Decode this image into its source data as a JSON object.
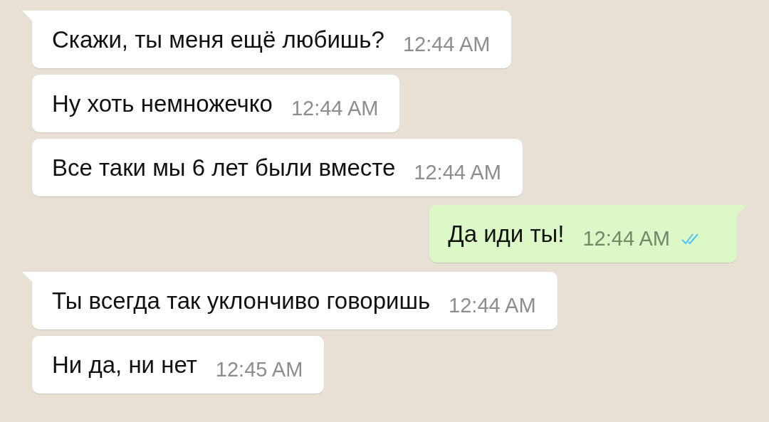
{
  "messages": [
    {
      "kind": "incoming",
      "tail": true,
      "text": "Скажи, ты меня ещё любишь?",
      "time": "12:44 AM"
    },
    {
      "kind": "incoming",
      "tail": false,
      "text": "Ну хоть немножечко",
      "time": "12:44 AM"
    },
    {
      "kind": "incoming",
      "tail": false,
      "text": "Все таки мы 6 лет были вместе",
      "time": "12:44 AM"
    },
    {
      "kind": "outgoing",
      "tail": true,
      "text": "Да иди ты!",
      "time": "12:44 AM",
      "read": true
    },
    {
      "kind": "incoming",
      "tail": true,
      "text": "Ты всегда так уклончиво говоришь",
      "time": "12:44 AM"
    },
    {
      "kind": "incoming",
      "tail": false,
      "text": "Ни да, ни нет",
      "time": "12:45 AM"
    }
  ]
}
